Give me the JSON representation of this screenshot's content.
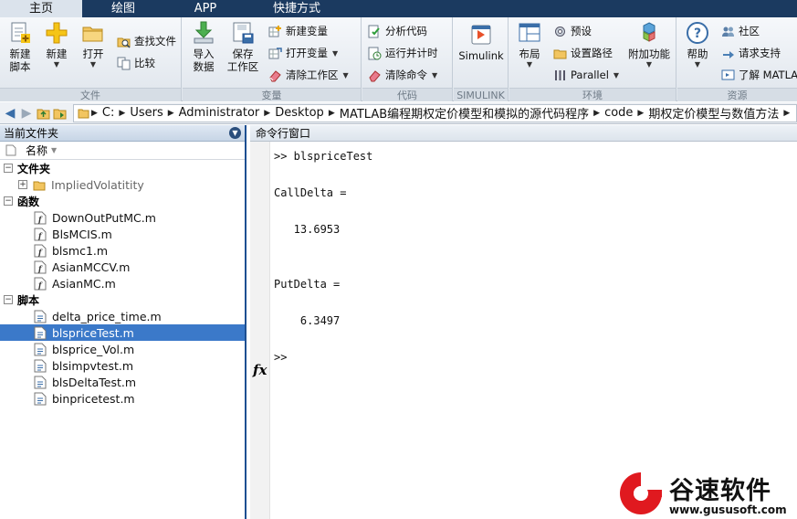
{
  "tabs": [
    {
      "label": "主页",
      "active": true
    },
    {
      "label": "绘图",
      "active": false
    },
    {
      "label": "APP",
      "active": false
    },
    {
      "label": "快捷方式",
      "active": false
    }
  ],
  "ribbon": {
    "file": {
      "group_label": "文件",
      "new_script": [
        "新建",
        "脚本"
      ],
      "new": "新建",
      "open": "打开",
      "find_files": "查找文件",
      "compare": "比较"
    },
    "variable": {
      "group_label": "变量",
      "import_data": [
        "导入",
        "数据"
      ],
      "save_workspace": [
        "保存",
        "工作区"
      ],
      "new_variable": "新建变量",
      "open_variable": "打开变量",
      "clear_workspace": "清除工作区"
    },
    "code": {
      "group_label": "代码",
      "analyze_code": "分析代码",
      "run_and_time": "运行并计时",
      "clear_commands": "清除命令"
    },
    "simulink": {
      "group_label": "SIMULINK",
      "simulink": "Simulink"
    },
    "environment": {
      "group_label": "环境",
      "layout": "布局",
      "preferences": "预设",
      "set_path": "设置路径",
      "parallel": "Parallel",
      "addons": "附加功能"
    },
    "resources": {
      "group_label": "资源",
      "help": "帮助",
      "community": "社区",
      "request_support": "请求支持",
      "learn_matlab": "了解 MATLAB"
    }
  },
  "address": {
    "breadcrumbs": [
      "C:",
      "Users",
      "Administrator",
      "Desktop",
      "MATLAB编程期权定价模型和模拟的源代码程序",
      "code",
      "期权定价模型与数值方法"
    ]
  },
  "file_browser": {
    "title": "当前文件夹",
    "column_name": "名称",
    "sections": [
      {
        "label": "文件夹",
        "items": [
          {
            "name": "ImpliedVolatitity",
            "type": "folder"
          }
        ]
      },
      {
        "label": "函数",
        "items": [
          {
            "name": "DownOutPutMC.m",
            "type": "function"
          },
          {
            "name": "BlsMCIS.m",
            "type": "function"
          },
          {
            "name": "blsmc1.m",
            "type": "function"
          },
          {
            "name": "AsianMCCV.m",
            "type": "function"
          },
          {
            "name": "AsianMC.m",
            "type": "function"
          }
        ]
      },
      {
        "label": "脚本",
        "items": [
          {
            "name": "delta_price_time.m",
            "type": "script"
          },
          {
            "name": "blspriceTest.m",
            "type": "script",
            "selected": true
          },
          {
            "name": "blsprice_Vol.m",
            "type": "script"
          },
          {
            "name": "blsimpvtest.m",
            "type": "script"
          },
          {
            "name": "blsDeltaTest.m",
            "type": "script"
          },
          {
            "name": "binpricetest.m",
            "type": "script"
          }
        ]
      }
    ]
  },
  "command_window": {
    "title": "命令行窗口",
    "lines": [
      ">> blspriceTest",
      "CallDelta =",
      "   13.6953",
      "PutDelta =",
      "    6.3497"
    ],
    "prompt": ">>",
    "fx_label": "fx"
  },
  "watermark": {
    "brand": "谷速软件",
    "url": "www.gususoft.com"
  },
  "colors": {
    "tabbar": "#1b3a60",
    "selection": "#3b79c9",
    "panel_border": "#1d4f91",
    "watermark_red": "#e0191f"
  }
}
